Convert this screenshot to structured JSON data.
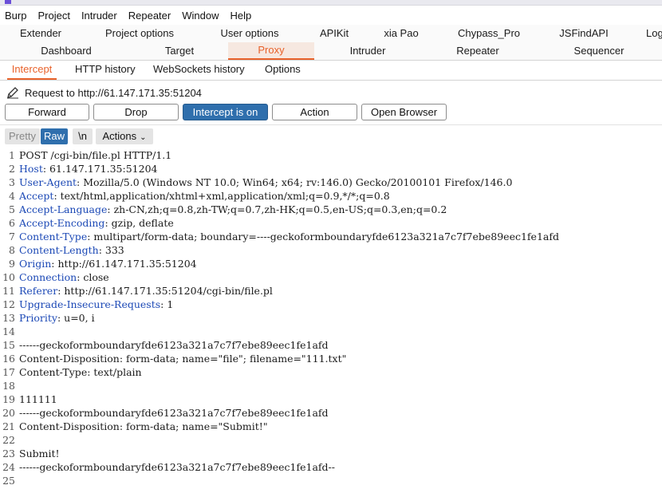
{
  "menu": [
    "Burp",
    "Project",
    "Intruder",
    "Repeater",
    "Window",
    "Help"
  ],
  "tabs_row1": [
    "Extender",
    "Project options",
    "User options",
    "APIKit",
    "xia Pao",
    "Chypass_Pro",
    "JSFindAPI",
    "Log"
  ],
  "tabs_row2": [
    "Dashboard",
    "Target",
    "Proxy",
    "Intruder",
    "Repeater",
    "Sequencer"
  ],
  "active_tab_row2": "Proxy",
  "proxy_tabs": [
    "Intercept",
    "HTTP history",
    "WebSockets history",
    "Options"
  ],
  "active_proxy_tab": "Intercept",
  "request_to": "Request to http://61.147.171.35:51204",
  "buttons": {
    "forward": "Forward",
    "drop": "Drop",
    "intercept": "Intercept is on",
    "action": "Action",
    "open_browser": "Open Browser"
  },
  "editor_toolbar": {
    "pretty": "Pretty",
    "raw": "Raw",
    "newline": "\\n",
    "actions": "Actions"
  },
  "accent_color": "#e8622b",
  "button_on_color": "#2f6fad",
  "request_lines": [
    {
      "num": "1",
      "key": "",
      "text": "POST /cgi-bin/file.pl HTTP/1.1"
    },
    {
      "num": "2",
      "key": "Host",
      "text": ": 61.147.171.35:51204"
    },
    {
      "num": "3",
      "key": "User-Agent",
      "text": ": Mozilla/5.0 (Windows NT 10.0; Win64; x64; rv:146.0) Gecko/20100101 Firefox/146.0"
    },
    {
      "num": "4",
      "key": "Accept",
      "text": ": text/html,application/xhtml+xml,application/xml;q=0.9,*/*;q=0.8"
    },
    {
      "num": "5",
      "key": "Accept-Language",
      "text": ": zh-CN,zh;q=0.8,zh-TW;q=0.7,zh-HK;q=0.5,en-US;q=0.3,en;q=0.2"
    },
    {
      "num": "6",
      "key": "Accept-Encoding",
      "text": ": gzip, deflate"
    },
    {
      "num": "7",
      "key": "Content-Type",
      "text": ": multipart/form-data; boundary=----geckoformboundaryfde6123a321a7c7f7ebe89eec1fe1afd"
    },
    {
      "num": "8",
      "key": "Content-Length",
      "text": ": 333"
    },
    {
      "num": "9",
      "key": "Origin",
      "text": ": http://61.147.171.35:51204"
    },
    {
      "num": "10",
      "key": "Connection",
      "text": ": close"
    },
    {
      "num": "11",
      "key": "Referer",
      "text": ": http://61.147.171.35:51204/cgi-bin/file.pl"
    },
    {
      "num": "12",
      "key": "Upgrade-Insecure-Requests",
      "text": ": 1"
    },
    {
      "num": "13",
      "key": "Priority",
      "text": ": u=0, i"
    },
    {
      "num": "14",
      "key": "",
      "text": ""
    },
    {
      "num": "15",
      "key": "",
      "text": "------geckoformboundaryfde6123a321a7c7f7ebe89eec1fe1afd"
    },
    {
      "num": "16",
      "key": "",
      "text": "Content-Disposition: form-data; name=\"file\"; filename=\"111.txt\""
    },
    {
      "num": "17",
      "key": "",
      "text": "Content-Type: text/plain"
    },
    {
      "num": "18",
      "key": "",
      "text": ""
    },
    {
      "num": "19",
      "key": "",
      "text": "111111"
    },
    {
      "num": "20",
      "key": "",
      "text": "------geckoformboundaryfde6123a321a7c7f7ebe89eec1fe1afd"
    },
    {
      "num": "21",
      "key": "",
      "text": "Content-Disposition: form-data; name=\"Submit!\""
    },
    {
      "num": "22",
      "key": "",
      "text": ""
    },
    {
      "num": "23",
      "key": "",
      "text": "Submit!"
    },
    {
      "num": "24",
      "key": "",
      "text": "------geckoformboundaryfde6123a321a7c7f7ebe89eec1fe1afd--"
    },
    {
      "num": "25",
      "key": "",
      "text": ""
    }
  ]
}
